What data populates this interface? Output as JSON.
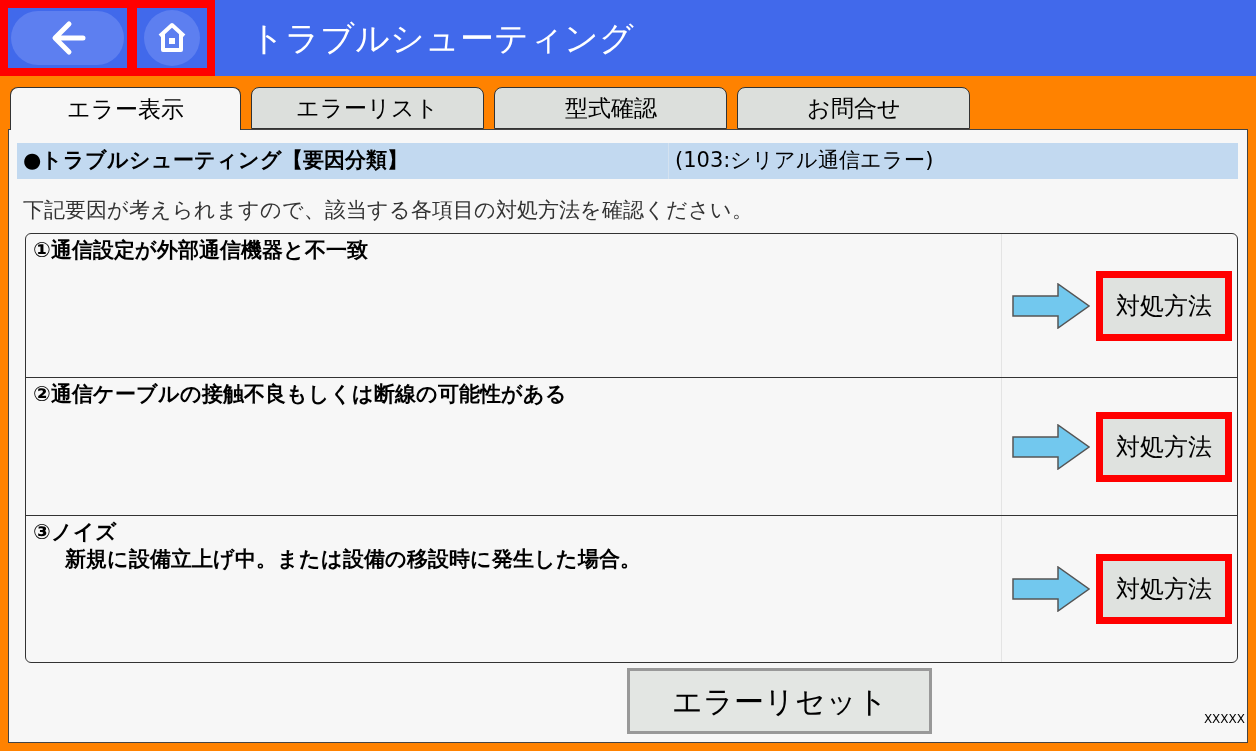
{
  "top_bar": {
    "back_button": {
      "highlighted": true
    },
    "home_button": {
      "highlighted": true
    },
    "title": "トラブルシューティング"
  },
  "tabs": [
    {
      "label": "エラー表示",
      "selected": true
    },
    {
      "label": "エラーリスト",
      "selected": false
    },
    {
      "label": "型式確認",
      "selected": false
    },
    {
      "label": "お問合せ",
      "selected": false
    }
  ],
  "header": {
    "title": "●トラブルシューティング【要因分類】",
    "error": "(103:シリアル通信エラー)"
  },
  "instruction": "下記要因が考えられますので、該当する各項目の対処方法を確認ください。",
  "causes": [
    {
      "title": "①通信設定が外部通信機器と不一致",
      "action": {
        "label": "対処方法",
        "highlighted": true
      }
    },
    {
      "title": "②通信ケーブルの接触不良もしくは断線の可能性がある",
      "action": {
        "label": "対処方法",
        "highlighted": true
      }
    },
    {
      "title": "③ノイズ",
      "detail": "新規に設備立上げ中。または設備の移設時に発生した場合。",
      "action": {
        "label": "対処方法",
        "highlighted": true
      }
    }
  ],
  "reset_button": {
    "label": "エラーリセット"
  },
  "footer_code": "XXXXX"
}
